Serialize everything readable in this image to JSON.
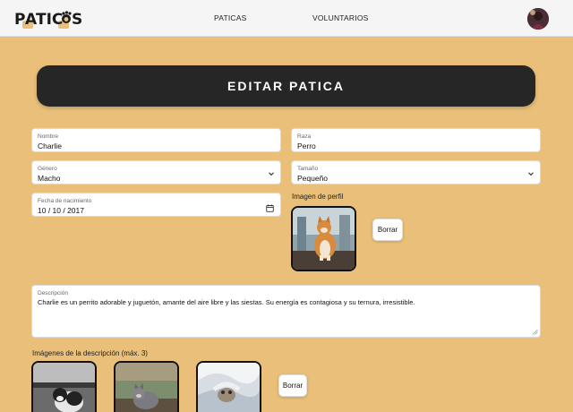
{
  "navbar": {
    "logo": "PATICAS",
    "links": [
      "PATICAS",
      "VOLUNTARIOS"
    ]
  },
  "page": {
    "title": "EDITAR PATICA"
  },
  "form": {
    "nombre": {
      "label": "Nombre",
      "value": "Charlie"
    },
    "raza": {
      "label": "Raza",
      "value": "Perro"
    },
    "genero": {
      "label": "Género",
      "value": "Macho"
    },
    "tamano": {
      "label": "Tamaño",
      "value": "Pequeño"
    },
    "fecha": {
      "label": "Fecha de nacimiento",
      "value": "10 / 10 / 2017"
    },
    "imagen_perfil_label": "Imagen de perfil",
    "borrar_label": "Borrar",
    "descripcion": {
      "label": "Descripción",
      "value": "Charlie es un perrito adorable y juguetón, amante del aire libre y las siestas. Su energía es contagiosa y su ternura, irresistible."
    },
    "imagenes_label": "Imágenes de la descripción (máx. 3)",
    "borrar_imagenes_label": "Borrar"
  },
  "colors": {
    "background": "#e9bf79",
    "navbar": "#f5f5f6",
    "title_bar": "#262626"
  }
}
